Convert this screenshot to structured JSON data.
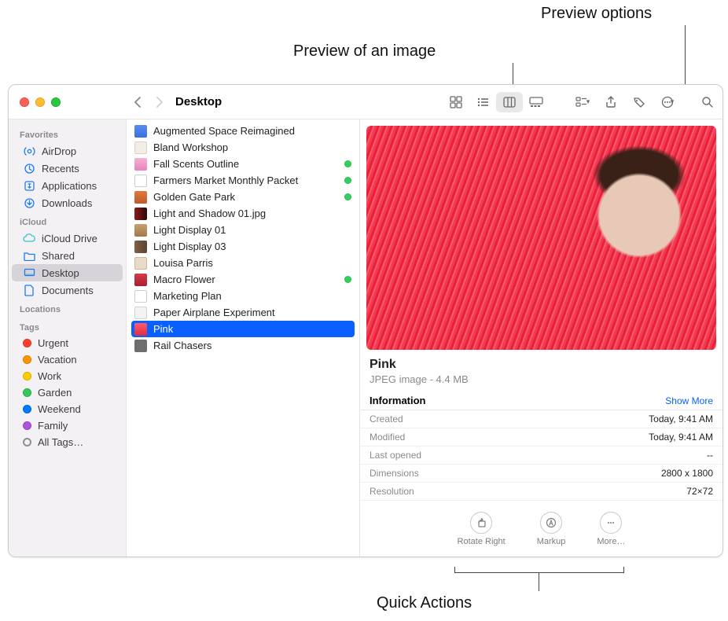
{
  "callouts": {
    "preview_image": "Preview of an image",
    "preview_options": "Preview options",
    "quick_actions": "Quick Actions"
  },
  "toolbar": {
    "location": "Desktop"
  },
  "sidebar": {
    "sections": [
      {
        "title": "Favorites",
        "items": [
          {
            "label": "AirDrop"
          },
          {
            "label": "Recents"
          },
          {
            "label": "Applications"
          },
          {
            "label": "Downloads"
          }
        ]
      },
      {
        "title": "iCloud",
        "items": [
          {
            "label": "iCloud Drive"
          },
          {
            "label": "Shared"
          },
          {
            "label": "Desktop"
          },
          {
            "label": "Documents"
          }
        ]
      },
      {
        "title": "Locations",
        "items": []
      },
      {
        "title": "Tags",
        "items": [
          {
            "label": "Urgent",
            "color": "#ff3b30"
          },
          {
            "label": "Vacation",
            "color": "#ff9500"
          },
          {
            "label": "Work",
            "color": "#ffcc00"
          },
          {
            "label": "Garden",
            "color": "#34c759"
          },
          {
            "label": "Weekend",
            "color": "#007aff"
          },
          {
            "label": "Family",
            "color": "#af52de"
          },
          {
            "label": "All Tags…"
          }
        ]
      }
    ]
  },
  "files": [
    {
      "name": "Augmented Space Reimagined",
      "tag": false
    },
    {
      "name": "Bland Workshop",
      "tag": false
    },
    {
      "name": "Fall Scents Outline",
      "tag": true
    },
    {
      "name": "Farmers Market Monthly Packet",
      "tag": true
    },
    {
      "name": "Golden Gate Park",
      "tag": true
    },
    {
      "name": "Light and Shadow 01.jpg",
      "tag": false
    },
    {
      "name": "Light Display 01",
      "tag": false
    },
    {
      "name": "Light Display 03",
      "tag": false
    },
    {
      "name": "Louisa Parris",
      "tag": false
    },
    {
      "name": "Macro Flower",
      "tag": true
    },
    {
      "name": "Marketing Plan",
      "tag": false
    },
    {
      "name": "Paper Airplane Experiment",
      "tag": false
    },
    {
      "name": "Pink",
      "tag": false,
      "selected": true
    },
    {
      "name": "Rail Chasers",
      "tag": false
    }
  ],
  "preview": {
    "title": "Pink",
    "subtitle": "JPEG image - 4.4 MB",
    "info_label": "Information",
    "show_more": "Show More",
    "rows": [
      {
        "k": "Created",
        "v": "Today, 9:41 AM"
      },
      {
        "k": "Modified",
        "v": "Today, 9:41 AM"
      },
      {
        "k": "Last opened",
        "v": "--"
      },
      {
        "k": "Dimensions",
        "v": "2800 x 1800"
      },
      {
        "k": "Resolution",
        "v": "72×72"
      }
    ],
    "quick": [
      {
        "label": "Rotate Right"
      },
      {
        "label": "Markup"
      },
      {
        "label": "More…"
      }
    ]
  }
}
